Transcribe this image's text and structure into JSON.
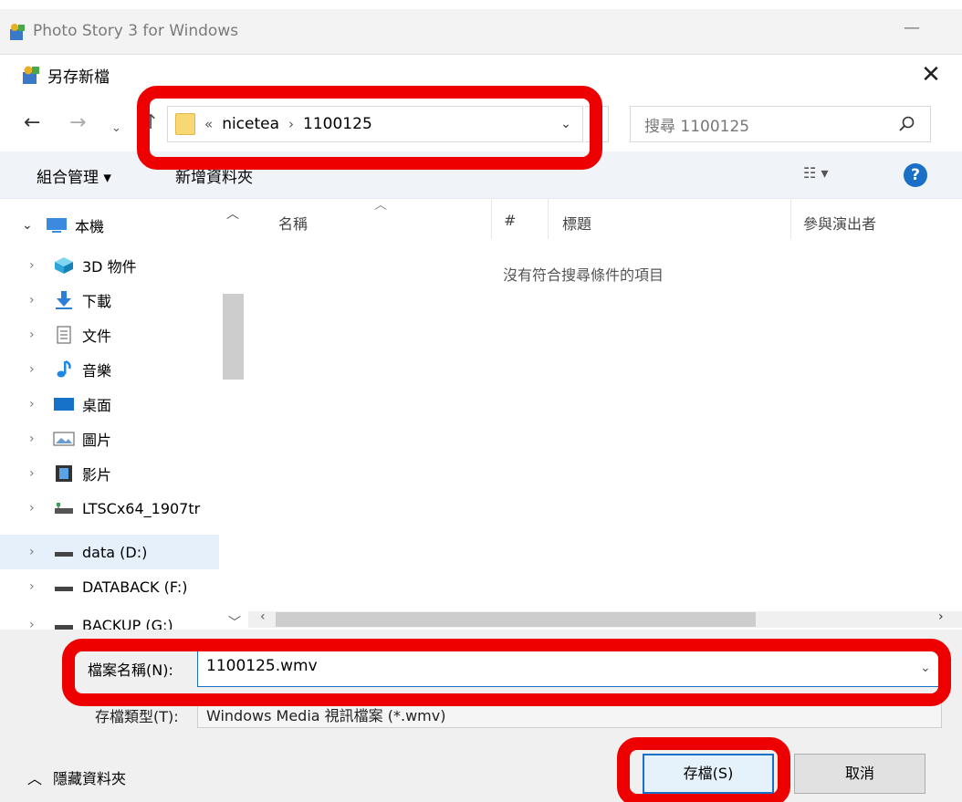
{
  "app": {
    "title": "Photo Story 3 for Windows",
    "minimize_glyph": "—"
  },
  "dialog": {
    "title": "另存新檔",
    "close_glyph": "✕",
    "address": {
      "prefix": "«",
      "crumbs": [
        "nicetea",
        "1100125"
      ],
      "separator": "›"
    },
    "search_placeholder": "搜尋 1100125",
    "toolbar": {
      "organize": "組合管理 ▾",
      "new_folder": "新增資料夾",
      "view": "▾",
      "help": "?"
    },
    "nav": [
      {
        "label": "本機",
        "icon": "pc-icon",
        "root": true
      },
      {
        "label": "3D 物件",
        "icon": "3d-objects-icon"
      },
      {
        "label": "下載",
        "icon": "download-icon"
      },
      {
        "label": "文件",
        "icon": "documents-icon"
      },
      {
        "label": "音樂",
        "icon": "music-icon"
      },
      {
        "label": "桌面",
        "icon": "desktop-icon"
      },
      {
        "label": "圖片",
        "icon": "pictures-icon"
      },
      {
        "label": "影片",
        "icon": "videos-icon"
      },
      {
        "label": "LTSCx64_1907tr",
        "icon": "network-drive-icon"
      },
      {
        "label": "data (D:)",
        "icon": "drive-icon",
        "selected": true
      },
      {
        "label": "DATABACK (F:)",
        "icon": "drive-icon"
      },
      {
        "label": "BACKUP (G:)",
        "icon": "drive-icon"
      }
    ],
    "columns": [
      "名稱",
      "#",
      "標題",
      "參與演出者"
    ],
    "empty_message": "沒有符合搜尋條件的項目",
    "filename_label": "檔案名稱(N):",
    "filename_value": "1100125.wmv",
    "filetype_label": "存檔類型(T):",
    "filetype_value": "Windows Media 視訊檔案 (*.wmv)",
    "hide_folders": "隱藏資料夾",
    "save_button": "存檔(S)",
    "cancel_button": "取消"
  },
  "colors": {
    "accent": "#1a70c7",
    "highlight": "#ee0000",
    "folder": "#f8d775"
  }
}
